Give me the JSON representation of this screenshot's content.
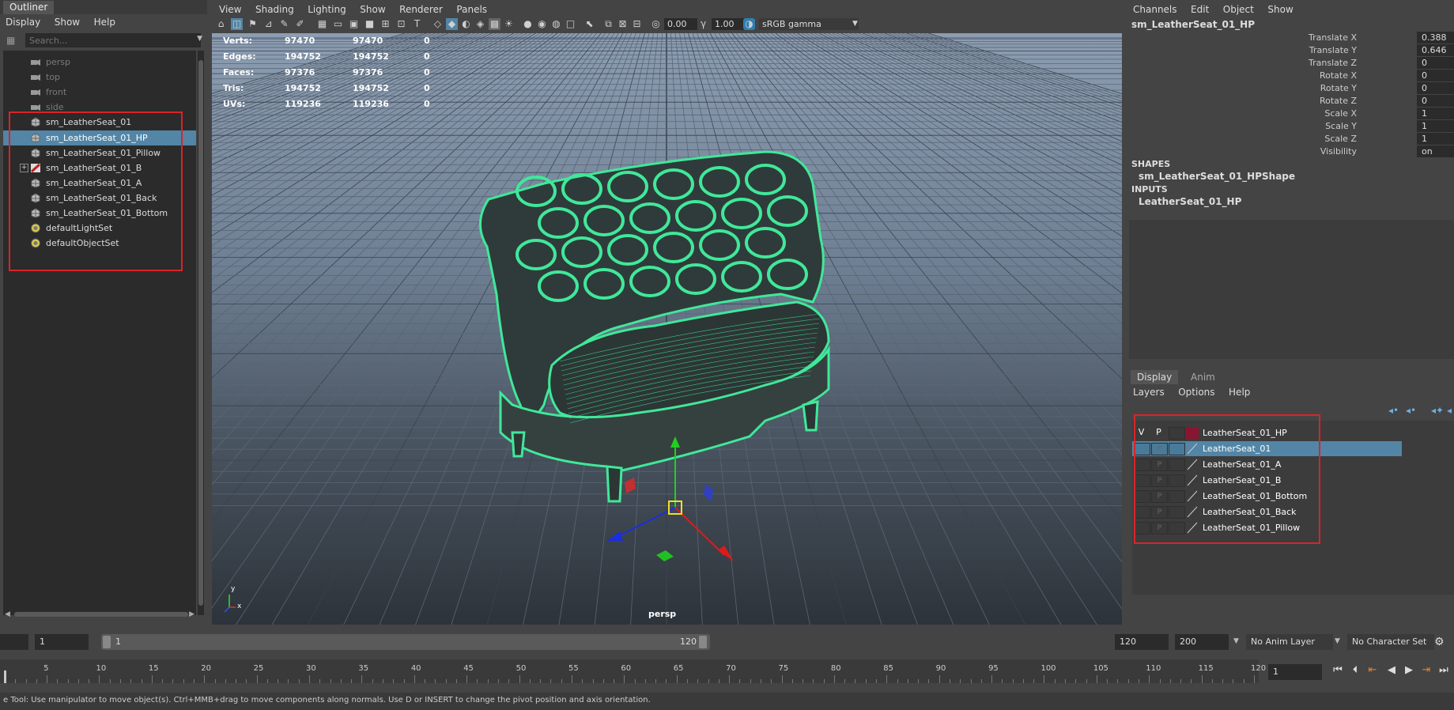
{
  "outliner": {
    "title": "Outliner",
    "menu": [
      "Display",
      "Show",
      "Help"
    ],
    "search_placeholder": "Search...",
    "items": [
      {
        "label": "persp",
        "icon": "camera-icon",
        "dim": true
      },
      {
        "label": "top",
        "icon": "camera-icon",
        "dim": true
      },
      {
        "label": "front",
        "icon": "camera-icon",
        "dim": true
      },
      {
        "label": "side",
        "icon": "camera-icon",
        "dim": true
      },
      {
        "label": "sm_LeatherSeat_01",
        "icon": "mesh-icon"
      },
      {
        "label": "sm_LeatherSeat_01_HP",
        "icon": "mesh-icon",
        "selected": true
      },
      {
        "label": "sm_LeatherSeat_01_Pillow",
        "icon": "mesh-icon"
      },
      {
        "label": "sm_LeatherSeat_01_B",
        "icon": "group-icon",
        "expandable": true
      },
      {
        "label": "sm_LeatherSeat_01_A",
        "icon": "mesh-icon"
      },
      {
        "label": "sm_LeatherSeat_01_Back",
        "icon": "mesh-icon"
      },
      {
        "label": "sm_LeatherSeat_01_Bottom",
        "icon": "mesh-icon"
      },
      {
        "label": "defaultLightSet",
        "icon": "set-icon"
      },
      {
        "label": "defaultObjectSet",
        "icon": "set-icon"
      }
    ]
  },
  "viewport": {
    "menu": [
      "View",
      "Shading",
      "Lighting",
      "Show",
      "Renderer",
      "Panels"
    ],
    "toolbar": {
      "exposure": "0.00",
      "gamma": "1.00",
      "colorspace": "sRGB gamma"
    },
    "hud": [
      {
        "label": "Verts:",
        "a": "97470",
        "b": "97470",
        "c": "0"
      },
      {
        "label": "Edges:",
        "a": "194752",
        "b": "194752",
        "c": "0"
      },
      {
        "label": "Faces:",
        "a": "97376",
        "b": "97376",
        "c": "0"
      },
      {
        "label": "Tris:",
        "a": "194752",
        "b": "194752",
        "c": "0"
      },
      {
        "label": "UVs:",
        "a": "119236",
        "b": "119236",
        "c": "0"
      }
    ],
    "camera_label": "persp",
    "axis_y": "y",
    "axis_x": "x",
    "wire_color": "#40e89a"
  },
  "channelbox": {
    "menu": [
      "Channels",
      "Edit",
      "Object",
      "Show"
    ],
    "object_name": "sm_LeatherSeat_01_HP",
    "channels": [
      {
        "name": "Translate X",
        "value": "0.388"
      },
      {
        "name": "Translate Y",
        "value": "0.646"
      },
      {
        "name": "Translate Z",
        "value": "0"
      },
      {
        "name": "Rotate X",
        "value": "0"
      },
      {
        "name": "Rotate Y",
        "value": "0"
      },
      {
        "name": "Rotate Z",
        "value": "0"
      },
      {
        "name": "Scale X",
        "value": "1"
      },
      {
        "name": "Scale Y",
        "value": "1"
      },
      {
        "name": "Scale Z",
        "value": "1"
      },
      {
        "name": "Visibility",
        "value": "on"
      }
    ],
    "shapes_header": "SHAPES",
    "shape_name": "sm_LeatherSeat_01_HPShape",
    "inputs_header": "INPUTS",
    "input_name": "LeatherSeat_01_HP"
  },
  "layereditor": {
    "tabs": [
      "Display",
      "Anim"
    ],
    "menu": [
      "Layers",
      "Options",
      "Help"
    ],
    "header_v": "V",
    "header_p": "P",
    "layers": [
      {
        "name": "LeatherSeat_01_HP",
        "color": "#8a1530",
        "header": true
      },
      {
        "name": "LeatherSeat_01",
        "selected": true
      },
      {
        "name": "LeatherSeat_01_A"
      },
      {
        "name": "LeatherSeat_01_B"
      },
      {
        "name": "LeatherSeat_01_Bottom"
      },
      {
        "name": "LeatherSeat_01_Back"
      },
      {
        "name": "LeatherSeat_01_Pillow"
      }
    ]
  },
  "range": {
    "start": "1",
    "slider_start": "1",
    "slider_end": "120",
    "end": "120",
    "max": "200",
    "anim_layer": "No Anim Layer",
    "character_set": "No Character Set"
  },
  "timeslider": {
    "ticks": [
      "5",
      "10",
      "15",
      "20",
      "25",
      "30",
      "35",
      "40",
      "45",
      "50",
      "55",
      "60",
      "65",
      "70",
      "75",
      "80",
      "85",
      "90",
      "95",
      "100",
      "105",
      "110",
      "115",
      "120"
    ],
    "current_frame": "1"
  },
  "status": "e Tool: Use manipulator to move object(s). Ctrl+MMB+drag to move components along normals. Use D or INSERT to change the pivot position and axis orientation.",
  "colors": {
    "selection": "#5285a6",
    "annotation_red": "#d8242a"
  }
}
